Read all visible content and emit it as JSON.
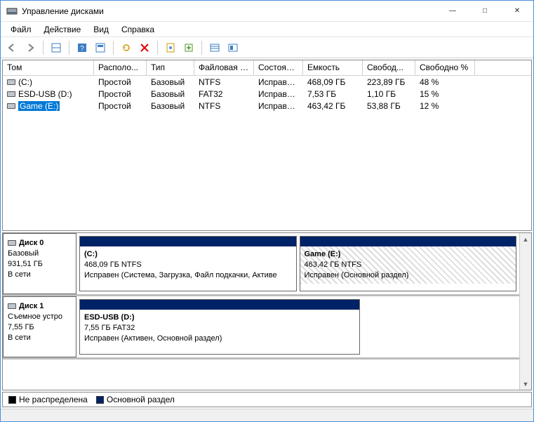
{
  "window": {
    "title": "Управление дисками"
  },
  "menu": {
    "file": "Файл",
    "action": "Действие",
    "view": "Вид",
    "help": "Справка"
  },
  "columns": [
    "Том",
    "Располо...",
    "Тип",
    "Файловая с...",
    "Состояние",
    "Емкость",
    "Свобод...",
    "Свободно %"
  ],
  "volumes": [
    {
      "name": "(C:)",
      "layout": "Простой",
      "type": "Базовый",
      "fs": "NTFS",
      "status": "Исправен...",
      "capacity": "468,09 ГБ",
      "free": "223,89 ГБ",
      "freepct": "48 %",
      "selected": false
    },
    {
      "name": "ESD-USB (D:)",
      "layout": "Простой",
      "type": "Базовый",
      "fs": "FAT32",
      "status": "Исправен...",
      "capacity": "7,53 ГБ",
      "free": "1,10 ГБ",
      "freepct": "15 %",
      "selected": false
    },
    {
      "name": "Game (E:)",
      "layout": "Простой",
      "type": "Базовый",
      "fs": "NTFS",
      "status": "Исправен...",
      "capacity": "463,42 ГБ",
      "free": "53,88 ГБ",
      "freepct": "12 %",
      "selected": true
    }
  ],
  "disks": [
    {
      "name": "Диск 0",
      "type": "Базовый",
      "size": "931,51 ГБ",
      "status": "В сети",
      "parts": [
        {
          "name": "(C:)",
          "detail": "468,09 ГБ NTFS",
          "status": "Исправен (Система, Загрузка, Файл подкачки, Активе",
          "hatched": false,
          "flex": "1"
        },
        {
          "name": "Game  (E:)",
          "detail": "463,42 ГБ NTFS",
          "status": "Исправен (Основной раздел)",
          "hatched": true,
          "flex": "1"
        }
      ]
    },
    {
      "name": "Диск 1",
      "type": "Съемное устро",
      "size": "7,55 ГБ",
      "status": "В сети",
      "parts": [
        {
          "name": "ESD-USB  (D:)",
          "detail": "7,55 ГБ FAT32",
          "status": "Исправен (Активен, Основной раздел)",
          "hatched": false,
          "flex": "0 0 400px"
        }
      ]
    }
  ],
  "legend": {
    "unallocated": "Не распределена",
    "primary": "Основной раздел"
  },
  "colors": {
    "partition_header": "#002266",
    "selection": "#0078d7",
    "unallocated": "#000000"
  }
}
